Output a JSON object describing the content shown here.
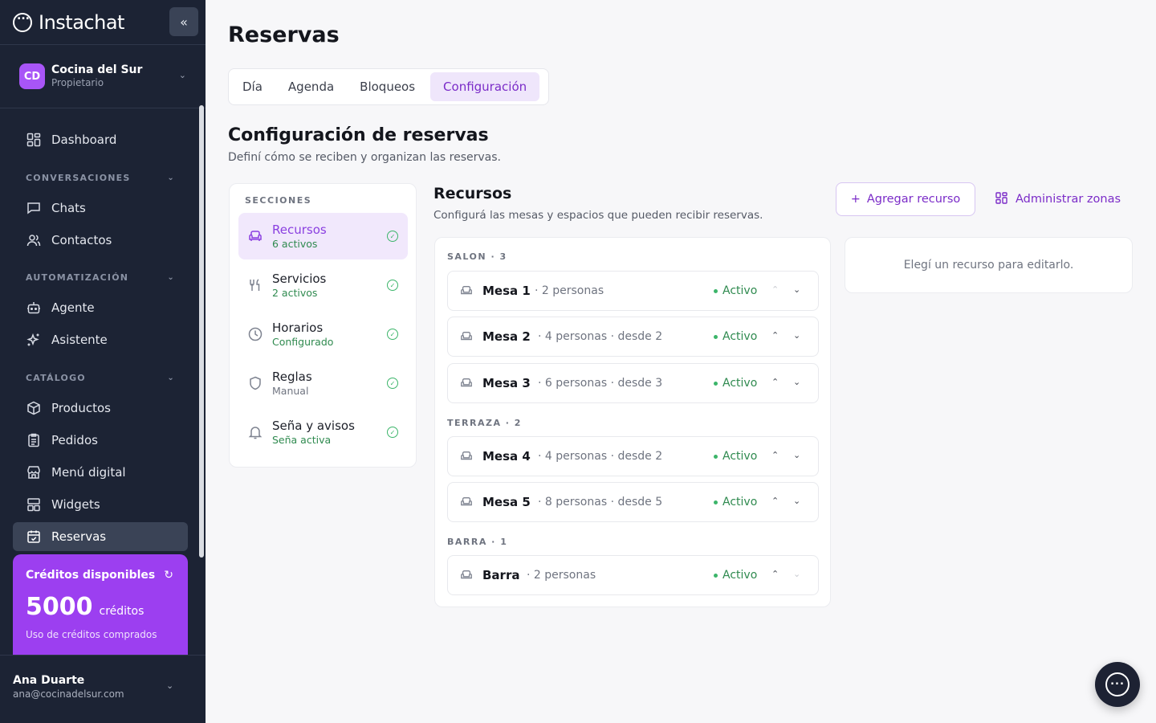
{
  "app": {
    "name": "Instachat",
    "collapse_icon": "«"
  },
  "org": {
    "initials": "CD",
    "name": "Cocina del Sur",
    "role": "Propietario"
  },
  "nav": {
    "dashboard": "Dashboard",
    "conversaciones_head": "CONVERSACIONES",
    "chats": "Chats",
    "contactos": "Contactos",
    "automatizacion_head": "AUTOMATIZACIÓN",
    "agente": "Agente",
    "asistente": "Asistente",
    "catalogo_head": "CATÁLOGO",
    "productos": "Productos",
    "pedidos": "Pedidos",
    "menu_digital": "Menú digital",
    "widgets": "Widgets",
    "reservas": "Reservas"
  },
  "credits": {
    "title": "Créditos disponibles",
    "amount": "5000",
    "unit": "créditos",
    "note": "Uso de créditos comprados"
  },
  "user": {
    "name": "Ana Duarte",
    "email": "ana@cocinadelsur.com"
  },
  "page": {
    "title": "Reservas",
    "tabs": [
      "Día",
      "Agenda",
      "Bloqueos",
      "Configuración"
    ],
    "active_tab": "Configuración",
    "config_title": "Configuración de reservas",
    "config_subtitle": "Definí cómo se reciben y organizan las reservas."
  },
  "sections": {
    "heading": "SECCIONES",
    "items": [
      {
        "label": "Recursos",
        "sub": "6 activos",
        "icon": "armchair-icon"
      },
      {
        "label": "Servicios",
        "sub": "2 activos",
        "icon": "utensils-icon"
      },
      {
        "label": "Horarios",
        "sub": "Configurado",
        "icon": "clock-icon"
      },
      {
        "label": "Reglas",
        "sub": "Manual",
        "icon": "shield-icon"
      },
      {
        "label": "Seña y avisos",
        "sub": "Seña activa",
        "icon": "bell-icon"
      }
    ]
  },
  "resources": {
    "title": "Recursos",
    "subtitle": "Configurá las mesas y espacios que pueden recibir reservas.",
    "add_button": "Agregar recurso",
    "zones_button": "Administrar zonas",
    "editor_placeholder": "Elegí un recurso para editarlo.",
    "zones": [
      {
        "heading": "SALON · 3"
      },
      {
        "heading": "TERRAZA · 2"
      },
      {
        "heading": "BARRA · 1"
      }
    ],
    "items": [
      {
        "name": "Mesa 1",
        "detail": "· 2 personas",
        "status": "Activo"
      },
      {
        "name": "Mesa 2",
        "detail": "· 4 personas · desde 2",
        "status": "Activo"
      },
      {
        "name": "Mesa 3",
        "detail": "· 6 personas · desde 3",
        "status": "Activo"
      },
      {
        "name": "Mesa 4",
        "detail": "· 4 personas · desde 2",
        "status": "Activo"
      },
      {
        "name": "Mesa 5",
        "detail": "· 8 personas · desde 5",
        "status": "Activo"
      },
      {
        "name": "Barra",
        "detail": "· 2 personas",
        "status": "Activo"
      }
    ]
  },
  "colors": {
    "sidebar": "#1c2334",
    "accent": "#9c3ff0",
    "active_text": "#7b2cc8",
    "success": "#2f8a4f"
  }
}
